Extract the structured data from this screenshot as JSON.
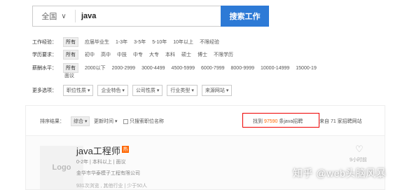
{
  "search": {
    "region": "全国",
    "keyword": "java",
    "button": "搜索工作"
  },
  "filters": {
    "experience": {
      "label": "工作经验：",
      "options": [
        "所有",
        "应届毕业生",
        "1-3年",
        "3-5年",
        "5-10年",
        "10年以上",
        "不限经验"
      ]
    },
    "education": {
      "label": "学历要求：",
      "options": [
        "所有",
        "初中",
        "高中",
        "中技",
        "中专",
        "大专",
        "本科",
        "硕士",
        "博士",
        "不限学历"
      ]
    },
    "salary": {
      "label": "薪酬水平：",
      "options": [
        "所有",
        "2000以下",
        "2000-2999",
        "3000-4499",
        "4500-5999",
        "6000-7999",
        "8000-9999",
        "10000-14999",
        "15000-19"
      ],
      "overflow": "面议"
    },
    "more": {
      "label": "更多选项：",
      "dropdowns": [
        "职位性质",
        "企业特色",
        "公司性质",
        "行业类型",
        "来源网站"
      ]
    }
  },
  "sortbar": {
    "label": "排序结果：",
    "sort_options": [
      "综合",
      "更新时间"
    ],
    "checkbox_label": "只搜索职位名称",
    "found_prefix": "找到",
    "found_count": "97590",
    "found_suffix": "条java招聘",
    "sites_text": "来自 71 家招聘网站"
  },
  "job": {
    "title": "java工程师",
    "hot_badge": "热",
    "meta": "0-2年 | 本科以上 | 面议",
    "company": "金华市华泰模子工程有限公司",
    "views": "931次浏览 , 其他行业 | 少于50人",
    "time": "9小时前",
    "logo": "Logo"
  },
  "watermark": "知乎 @web头脑风暴",
  "colors": {
    "accent": "#2d7ad6",
    "highlight": "#f60",
    "box": "#e00"
  }
}
